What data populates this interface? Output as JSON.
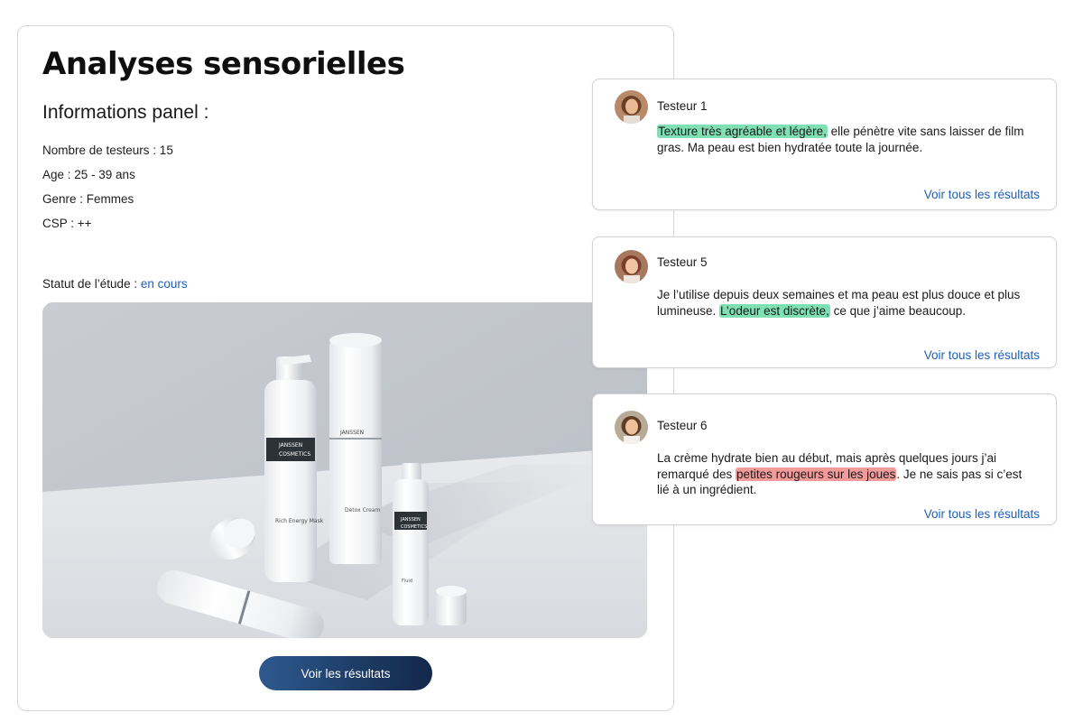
{
  "main": {
    "title": "Analyses sensorielles",
    "panel_heading": "Informations panel :",
    "info": [
      "Nombre de testeurs : 15",
      "Age : 25 - 39 ans",
      "Genre : Femmes",
      "CSP : ++"
    ],
    "status_label": "Statut de l’étude : ",
    "status_value": "en cours",
    "results_button": "Voir les résultats",
    "image": {
      "brand_line1": "JANSSEN",
      "brand_line2": "COSMETICS",
      "tall_bottle_name": "Rich Energy Mask",
      "jar_name": "Detox Cream",
      "small_bottle_name": "Fluid"
    }
  },
  "reviews": [
    {
      "name": "Testeur 1",
      "highlight_color": "green",
      "parts": [
        {
          "text": "Texture très agréable et légère,",
          "highlight": "green"
        },
        {
          "text": " elle pénètre vite sans laisser de film gras. Ma peau est bien hydratée toute la journée.",
          "highlight": ""
        }
      ],
      "link": "Voir tous les résultats"
    },
    {
      "name": "Testeur 5",
      "parts": [
        {
          "text": "Je l’utilise depuis deux semaines et ma peau est plus douce et plus lumineuse. ",
          "highlight": ""
        },
        {
          "text": "L’odeur est discrète,",
          "highlight": "green"
        },
        {
          "text": " ce que j’aime beaucoup.",
          "highlight": ""
        }
      ],
      "link": "Voir tous les résultats"
    },
    {
      "name": "Testeur 6",
      "parts": [
        {
          "text": "La crème hydrate bien au début, mais après quelques jours j’ai remarqué des ",
          "highlight": ""
        },
        {
          "text": "petites rougeurs sur les joues",
          "highlight": "red"
        },
        {
          "text": ". Je ne sais pas si c’est lié à un ingrédient.",
          "highlight": ""
        }
      ],
      "link": "Voir tous les résultats"
    }
  ],
  "colors": {
    "link": "#1d5fb8",
    "highlight_green": "#7fe0b4",
    "highlight_red": "#f39a9a",
    "button_start": "#2e5a8f",
    "button_end": "#13284a"
  }
}
